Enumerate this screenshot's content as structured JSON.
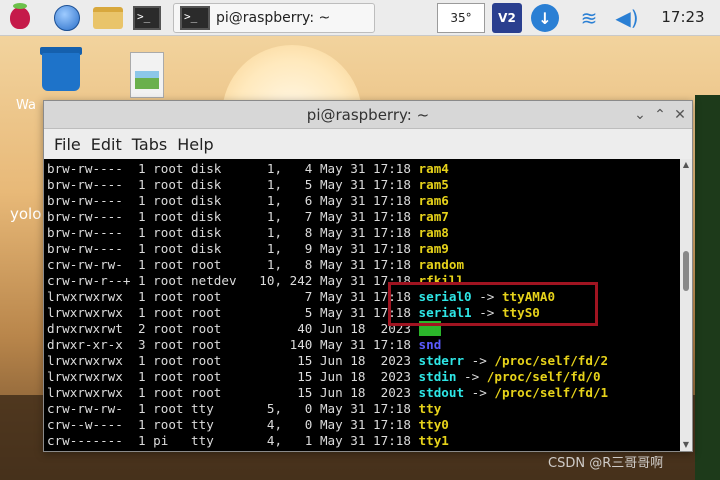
{
  "taskbar": {
    "terminal_icon_text": ">_",
    "task_title": "pi@raspberry: ~",
    "temperature": "35°",
    "vnc_label": "V2",
    "download_icon": "↓",
    "wifi_icon": "≋",
    "volume_icon": "◀)",
    "clock": "17:23"
  },
  "desktop": {
    "trash_label": "Wa",
    "yolo_label": "yolo"
  },
  "window": {
    "title": "pi@raspberry: ~",
    "min_glyph": "⌄",
    "max_glyph": "⌃",
    "close_glyph": "✕",
    "menu": [
      "File",
      "Edit",
      "Tabs",
      "Help"
    ]
  },
  "terminal": {
    "lines": [
      {
        "prefix": "brw-rw----  1 root disk      1,   4 May 31 17:18 ",
        "name": "ram4",
        "color": "yellow"
      },
      {
        "prefix": "brw-rw----  1 root disk      1,   5 May 31 17:18 ",
        "name": "ram5",
        "color": "yellow"
      },
      {
        "prefix": "brw-rw----  1 root disk      1,   6 May 31 17:18 ",
        "name": "ram6",
        "color": "yellow"
      },
      {
        "prefix": "brw-rw----  1 root disk      1,   7 May 31 17:18 ",
        "name": "ram7",
        "color": "yellow"
      },
      {
        "prefix": "brw-rw----  1 root disk      1,   8 May 31 17:18 ",
        "name": "ram8",
        "color": "yellow"
      },
      {
        "prefix": "brw-rw----  1 root disk      1,   9 May 31 17:18 ",
        "name": "ram9",
        "color": "yellow"
      },
      {
        "prefix": "crw-rw-rw-  1 root root      1,   8 May 31 17:18 ",
        "name": "random",
        "color": "yellow"
      },
      {
        "prefix": "crw-rw-r--+ 1 root netdev   10, 242 May 31 17:18 ",
        "name": "rfkill",
        "color": "yellow"
      },
      {
        "prefix": "lrwxrwxrwx  1 root root           7 May 31 17:18 ",
        "name": "serial0",
        "color": "cyan",
        "target": "ttyAMA0"
      },
      {
        "prefix": "lrwxrwxrwx  1 root root           5 May 31 17:18 ",
        "name": "serial1",
        "color": "cyan",
        "target": "ttyS0"
      },
      {
        "prefix": "drwxrwxrwt  2 root root          40 Jun 18  2023 ",
        "name": "shm",
        "color": "greenbg"
      },
      {
        "prefix": "drwxr-xr-x  3 root root         140 May 31 17:18 ",
        "name": "snd",
        "color": "blue"
      },
      {
        "prefix": "lrwxrwxrwx  1 root root          15 Jun 18  2023 ",
        "name": "stderr",
        "color": "cyan",
        "target": "/proc/self/fd/2"
      },
      {
        "prefix": "lrwxrwxrwx  1 root root          15 Jun 18  2023 ",
        "name": "stdin",
        "color": "cyan",
        "target": "/proc/self/fd/0"
      },
      {
        "prefix": "lrwxrwxrwx  1 root root          15 Jun 18  2023 ",
        "name": "stdout",
        "color": "cyan",
        "target": "/proc/self/fd/1"
      },
      {
        "prefix": "crw-rw-rw-  1 root tty       5,   0 May 31 17:18 ",
        "name": "tty",
        "color": "yellow"
      },
      {
        "prefix": "crw--w----  1 root tty       4,   0 May 31 17:18 ",
        "name": "tty0",
        "color": "yellow"
      },
      {
        "prefix": "crw-------  1 pi   tty       4,   1 May 31 17:18 ",
        "name": "tty1",
        "color": "yellow"
      }
    ],
    "arrow": " -> "
  },
  "colors": {
    "yellow": "#e6d21a",
    "cyan": "#2ee6e6",
    "blue": "#5b5bff",
    "greenbg": "#2bb52b",
    "highlight_box": "#a01421"
  },
  "watermark": "CSDN @R三哥哥啊"
}
